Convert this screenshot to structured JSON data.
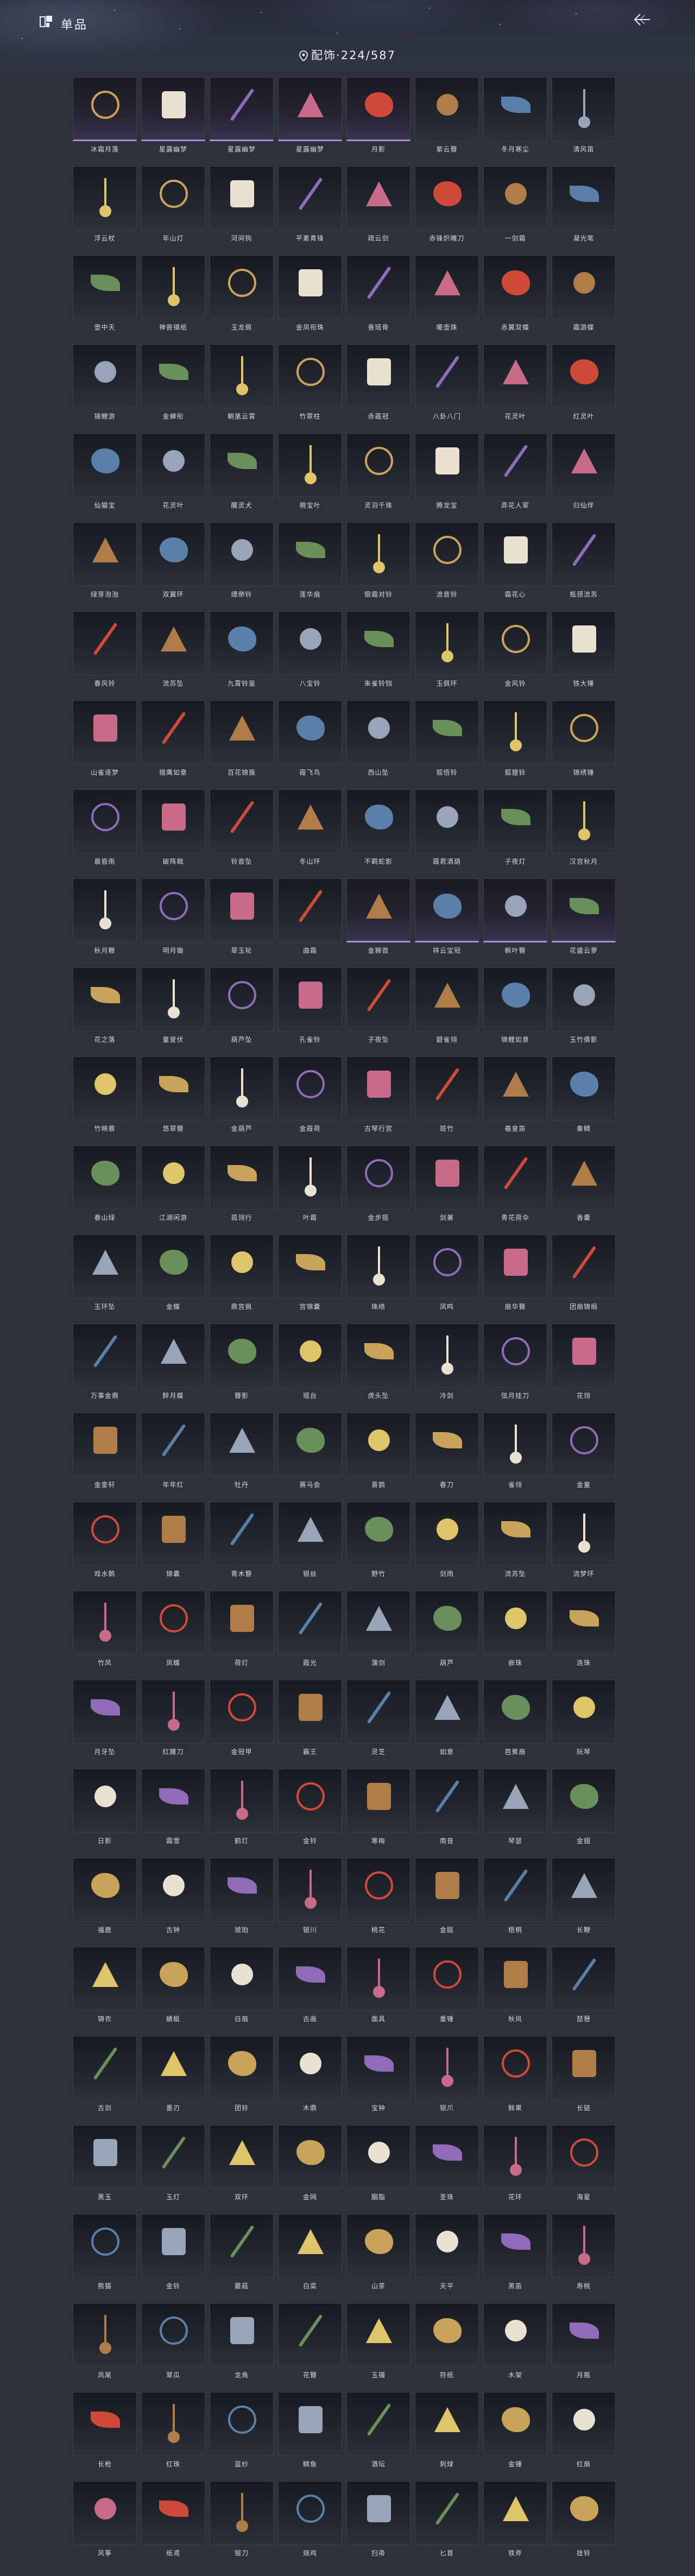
{
  "header": {
    "title": "单品",
    "count_label": "配饰·224/587",
    "back_icon": "back-arrow-icon",
    "logo_icon": "collection-icon"
  },
  "colors": {
    "background": "#2c313b",
    "purple_rarity": "#a88ed8",
    "gold_rarity": "#d8bf7a"
  },
  "rows": [
    {
      "items": [
        "冰霜月落",
        "星露幽梦",
        "星露幽梦",
        "星露幽梦",
        "月影",
        "紫云簪",
        "冬月寒尘",
        "清风笛"
      ]
    },
    {
      "items": [
        "浮云杖",
        "年山灯",
        "河间钩",
        "平素青锋",
        "疏云剑",
        "赤锋炽魄刀",
        "一剑霜",
        "凝光笔"
      ]
    },
    {
      "items": [
        "壶中天",
        "神兽镇纸",
        "玉龙佩",
        "金凤衔珠",
        "香瑶骨",
        "暖壶珠",
        "赤翼双蝶",
        "霜游蝶"
      ]
    },
    {
      "items": [
        "锦鲤游",
        "金蝉衔",
        "朝凰云霄",
        "竹翠柱",
        "赤霞冠",
        "八卦八门",
        "花灵叶",
        "红灵叶"
      ]
    },
    {
      "items": [
        "仙猫宝",
        "花灵叶",
        "醒灵犬",
        "萌宝叶",
        "灵羽千珠",
        "腾龙宝",
        "弄花人冢",
        "归仙伴"
      ]
    },
    {
      "items": [
        "绿芽泡泡",
        "双翼环",
        "缥缈铃",
        "莲华扇",
        "银霜对铃",
        "流音铃",
        "霜花心",
        "瓶颈流苏"
      ]
    },
    {
      "items": [
        "春风铃",
        "流苏坠",
        "九霄铃鉴",
        "八宝铃",
        "朱雀铃铛",
        "玉佩环",
        "金风铃",
        "铁大锤"
      ]
    },
    {
      "items": [
        "山雀逐梦",
        "猎鹰如意",
        "百花锦簇",
        "霞飞鸟",
        "西山坠",
        "狐悟铃",
        "狐狸铃",
        "锦绣锤"
      ]
    },
    {
      "items": [
        "晨昏雨",
        "破阵戟",
        "铃音坠",
        "冬山环",
        "不羁蛇影",
        "霞君酒葫",
        "子夜灯",
        "汉宫秋月"
      ]
    },
    {
      "items": [
        "秋月鞭",
        "明月锄",
        "翠玉轮",
        "曲霜",
        "金狮首",
        "祥云宝冠",
        "枫叶簪",
        "花盛云萝"
      ]
    },
    {
      "items": [
        "花之落",
        "童叟伏",
        "葫芦坠",
        "孔雀铃",
        "子夜坠",
        "碧雀翎",
        "锦鲤如意",
        "玉竹倩影"
      ]
    },
    {
      "items": [
        "竹映蓑",
        "悠翠簪",
        "金葫芦",
        "金霞荷",
        "古琴行宫",
        "斑竹",
        "羲皇笛",
        "秦鳞"
      ]
    },
    {
      "items": [
        "春山绿",
        "江湖闲游",
        "孤翎行",
        "叶霜",
        "金步摇",
        "剑兼",
        "青花荷伞",
        "香囊"
      ]
    },
    {
      "items": [
        "玉环坠",
        "金蝶",
        "鼎宫佩",
        "宫锦囊",
        "珠络",
        "凤鸣",
        "扇华簪",
        "团扇锦缎"
      ]
    },
    {
      "items": [
        "万事金鼎",
        "醉月蝶",
        "簪影",
        "瑶台",
        "虎头坠",
        "冷剑",
        "弦月挂刀",
        "花翎"
      ]
    },
    {
      "items": [
        "金銮轩",
        "年年红",
        "牡丹",
        "赛马会",
        "喜鹊",
        "春刀",
        "雀翎",
        "金童"
      ]
    },
    {
      "items": [
        "戏水鹅",
        "锦囊",
        "青木簪",
        "银丝",
        "野竹",
        "剑雨",
        "流苏坠",
        "流梦环"
      ]
    },
    {
      "items": [
        "竹凤",
        "凤蝶",
        "荷灯",
        "霞光",
        "蒲剑",
        "葫芦",
        "嵌珠",
        "连珠"
      ]
    },
    {
      "items": [
        "月牙坠",
        "红腰刀",
        "金冠甲",
        "霸王",
        "灵芝",
        "如意",
        "芭蕉扇",
        "阮琴"
      ]
    },
    {
      "items": [
        "日影",
        "霜雪",
        "鹤灯",
        "金铃",
        "寒梅",
        "南音",
        "琴瑟",
        "金翅"
      ]
    },
    {
      "items": [
        "福鹿",
        "古钟",
        "琥珀",
        "银川",
        "桃花",
        "金瓯",
        "梧桐",
        "长鞭"
      ]
    },
    {
      "items": [
        "锦衣",
        "蜻蜓",
        "白扇",
        "古画",
        "面具",
        "重锤",
        "秋风",
        "琵琶"
      ]
    },
    {
      "items": [
        "古剑",
        "墨刃",
        "团铃",
        "木鼎",
        "宝钟",
        "银爪",
        "鲜果",
        "长链"
      ]
    },
    {
      "items": [
        "黑玉",
        "玉灯",
        "双环",
        "金网",
        "胭脂",
        "圣珠",
        "花环",
        "海星"
      ]
    },
    {
      "items": [
        "熊猫",
        "金铃",
        "蘑菇",
        "白菜",
        "山茶",
        "天平",
        "黑笛",
        "寿桃"
      ]
    },
    {
      "items": [
        "凤尾",
        "翠瓜",
        "龙角",
        "花簪",
        "玉镯",
        "符纸",
        "木架",
        "月瓶"
      ]
    },
    {
      "items": [
        "长枪",
        "红珠",
        "蓝纱",
        "鳞鱼",
        "酒坛",
        "刺球",
        "金锤",
        "红扇"
      ]
    },
    {
      "items": [
        "风筝",
        "纸鸢",
        "银刀",
        "烧鸡",
        "扫帚",
        "匕首",
        "铁斧",
        "挂铃"
      ]
    }
  ]
}
